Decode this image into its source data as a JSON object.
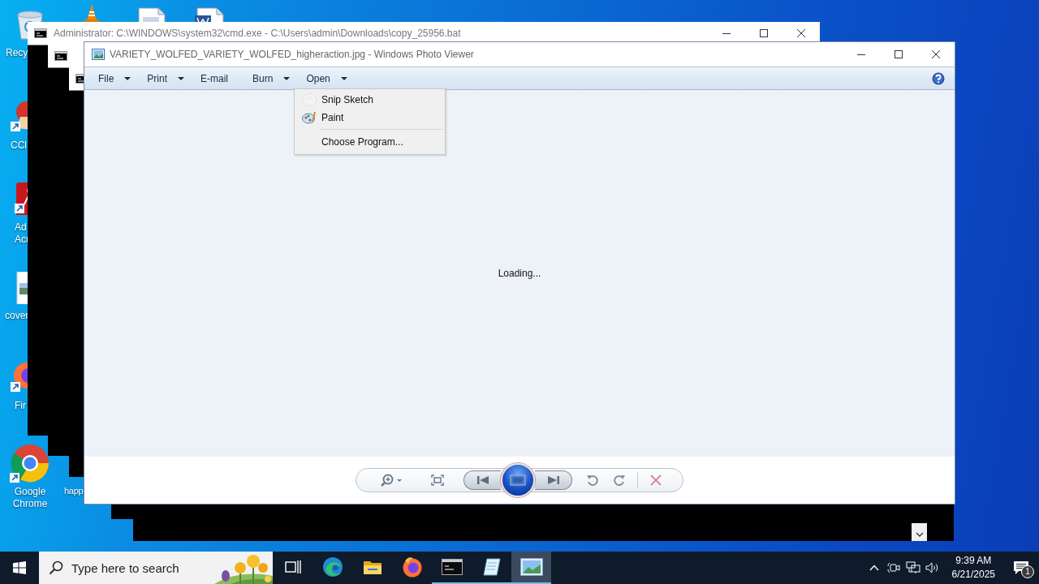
{
  "desktop_icons": [
    {
      "kind": "recycle-bin",
      "label": "Recy"
    },
    {
      "kind": "vlc"
    },
    {
      "kind": "document"
    },
    {
      "kind": "word-document"
    },
    {
      "kind": "ccleaner",
      "label": "CCl"
    },
    {
      "kind": "acrobat",
      "label": "Ad Acr"
    },
    {
      "kind": "image-file",
      "label": "cover"
    },
    {
      "kind": "firefox",
      "label": "Fir"
    },
    {
      "kind": "chrome",
      "label": "Google Chrome"
    },
    {
      "kind": "hidden",
      "label": "happ"
    }
  ],
  "console_windows": [
    {
      "kind": "console",
      "title": "Administrator: C:\\WINDOWS\\system32\\cmd.exe - C:\\Users\\admin\\Downloads\\copy_25956.bat"
    },
    {
      "kind": "console"
    },
    {
      "kind": "console"
    },
    {
      "kind": "console-body"
    },
    {
      "kind": "console-body"
    }
  ],
  "photo_viewer": {
    "title": "VARIETY_WOLFED_VARIETY_WOLFED_higheraction.jpg - Windows Photo Viewer",
    "menu": [
      {
        "label": "File",
        "has_menu": true
      },
      {
        "label": "Print",
        "has_menu": true
      },
      {
        "label": "E-mail",
        "has_menu": false
      },
      {
        "label": "Burn",
        "has_menu": true
      },
      {
        "label": "Open",
        "has_menu": true
      }
    ],
    "open_menu": [
      {
        "kind": "item",
        "label": "Snip  Sketch"
      },
      {
        "kind": "item",
        "label": "Paint"
      },
      {
        "kind": "separator"
      },
      {
        "kind": "item",
        "label": "Choose Program..."
      }
    ],
    "status": "Loading...",
    "controls": [
      {
        "kind": "zoom"
      },
      {
        "kind": "fit"
      },
      {
        "kind": "previous"
      },
      {
        "kind": "slideshow"
      },
      {
        "kind": "next"
      },
      {
        "kind": "rotate-left"
      },
      {
        "kind": "rotate-right"
      },
      {
        "kind": "divider"
      },
      {
        "kind": "delete"
      }
    ]
  },
  "taskbar": {
    "search": {
      "placeholder": "Type here to search"
    },
    "apps": [
      {
        "kind": "task-view",
        "running": false,
        "selected": false
      },
      {
        "kind": "edge",
        "running": false,
        "selected": false
      },
      {
        "kind": "explorer",
        "running": false,
        "selected": false
      },
      {
        "kind": "firefox",
        "running": false,
        "selected": false
      },
      {
        "kind": "console",
        "running": true,
        "selected": false
      },
      {
        "kind": "notepad",
        "running": true,
        "selected": false
      },
      {
        "kind": "photos",
        "running": true,
        "selected": true
      }
    ],
    "tray": [
      {
        "kind": "chevron"
      },
      {
        "kind": "meet"
      },
      {
        "kind": "network"
      },
      {
        "kind": "volume"
      }
    ],
    "time": "9:39 AM",
    "date": "6/21/2025",
    "notifications": "1"
  }
}
